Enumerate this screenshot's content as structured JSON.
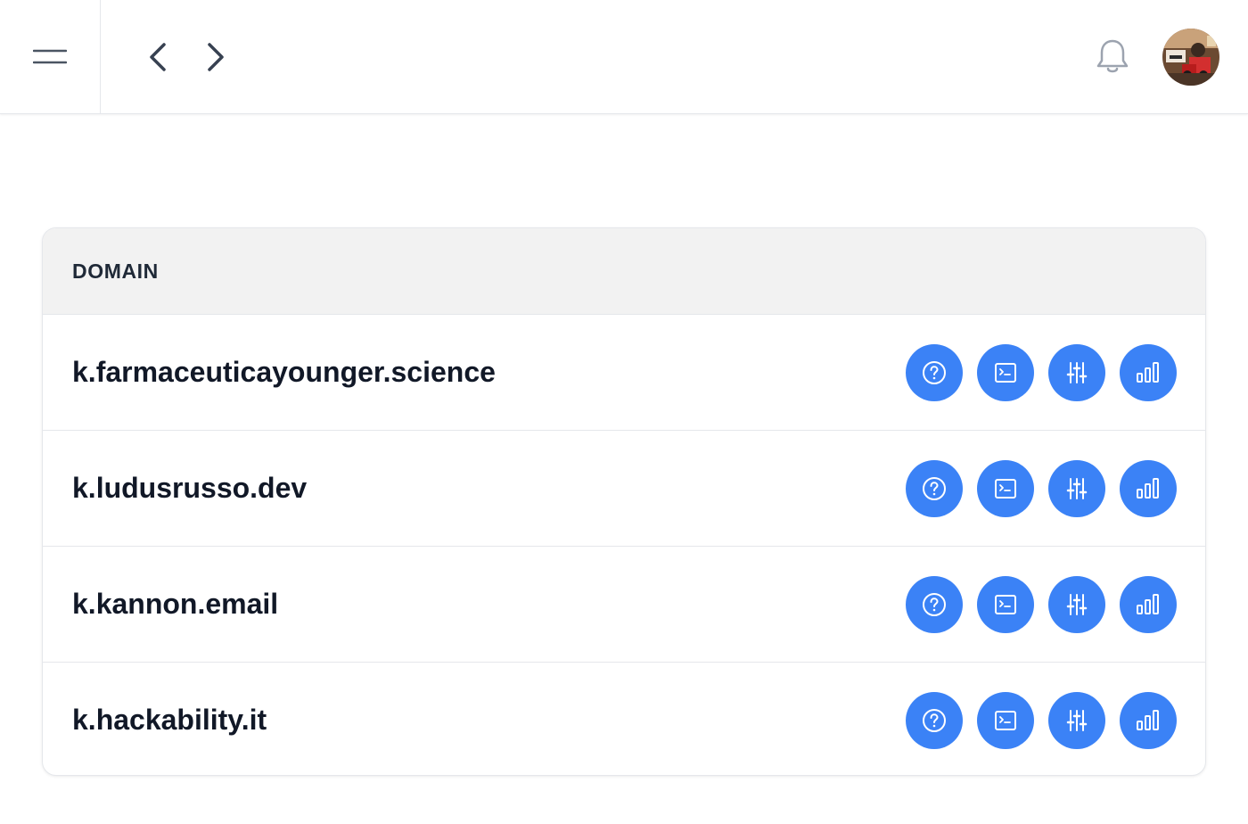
{
  "topbar": {
    "menu_icon": "menu-icon",
    "back_icon": "chevron-left-icon",
    "forward_icon": "chevron-right-icon",
    "notification_icon": "bell-icon"
  },
  "colors": {
    "accent": "#3b82f6",
    "header_bg": "#f2f2f2",
    "text": "#111827"
  },
  "table": {
    "columns": [
      "DOMAIN"
    ],
    "rows": [
      {
        "domain": "k.farmaceuticayounger.science"
      },
      {
        "domain": "k.ludusrusso.dev"
      },
      {
        "domain": "k.kannon.email"
      },
      {
        "domain": "k.hackability.it"
      }
    ],
    "row_actions": [
      "help-circle-icon",
      "terminal-icon",
      "sliders-icon",
      "bar-chart-icon"
    ]
  }
}
